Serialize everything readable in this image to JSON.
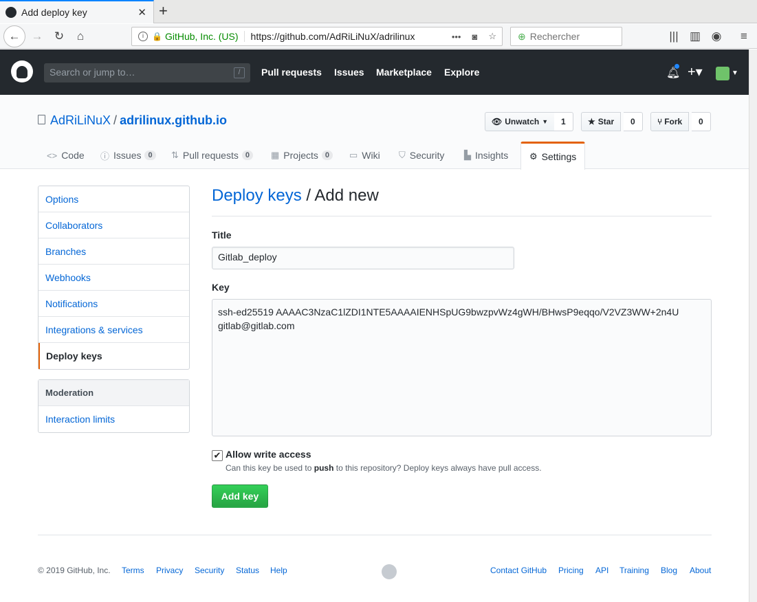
{
  "browser": {
    "tab_title": "Add deploy key",
    "identity": "GitHub, Inc. (US)",
    "url": "https://github.com/AdRiLiNuX/adrilinux",
    "search_placeholder": "Rechercher"
  },
  "header": {
    "search_placeholder": "Search or jump to…",
    "slash": "/",
    "nav": [
      "Pull requests",
      "Issues",
      "Marketplace",
      "Explore"
    ]
  },
  "repo": {
    "owner": "AdRiLiNuX",
    "name": "adrilinux.github.io",
    "unwatch_label": "Unwatch",
    "watch_count": "1",
    "star_label": "Star",
    "star_count": "0",
    "fork_label": "Fork",
    "fork_count": "0",
    "tabs": {
      "code": "Code",
      "issues": "Issues",
      "issues_count": "0",
      "pulls": "Pull requests",
      "pulls_count": "0",
      "projects": "Projects",
      "projects_count": "0",
      "wiki": "Wiki",
      "security": "Security",
      "insights": "Insights",
      "settings": "Settings"
    }
  },
  "sidebar": {
    "items": [
      "Options",
      "Collaborators",
      "Branches",
      "Webhooks",
      "Notifications",
      "Integrations & services",
      "Deploy keys"
    ],
    "moderation_header": "Moderation",
    "moderation_items": [
      "Interaction limits"
    ]
  },
  "main": {
    "breadcrumb_link": "Deploy keys",
    "breadcrumb_sep": "/",
    "heading": "Add new",
    "title_label": "Title",
    "title_value": "Gitlab_deploy",
    "key_label": "Key",
    "key_value": "ssh-ed25519 AAAAC3NzaC1lZDI1NTE5AAAAIENHSpUG9bwzpvWz4gWH/BHwsP9eqqo/V2VZ3WW+2n4U\ngitlab@gitlab.com",
    "write_access_label": "Allow write access",
    "write_access_checked": true,
    "note_pre": "Can this key be used to ",
    "note_bold": "push",
    "note_post": " to this repository? Deploy keys always have pull access.",
    "add_button": "Add key"
  },
  "footer": {
    "copyright": "© 2019 GitHub, Inc.",
    "left_links": [
      "Terms",
      "Privacy",
      "Security",
      "Status",
      "Help"
    ],
    "right_links": [
      "Contact GitHub",
      "Pricing",
      "API",
      "Training",
      "Blog",
      "About"
    ]
  }
}
